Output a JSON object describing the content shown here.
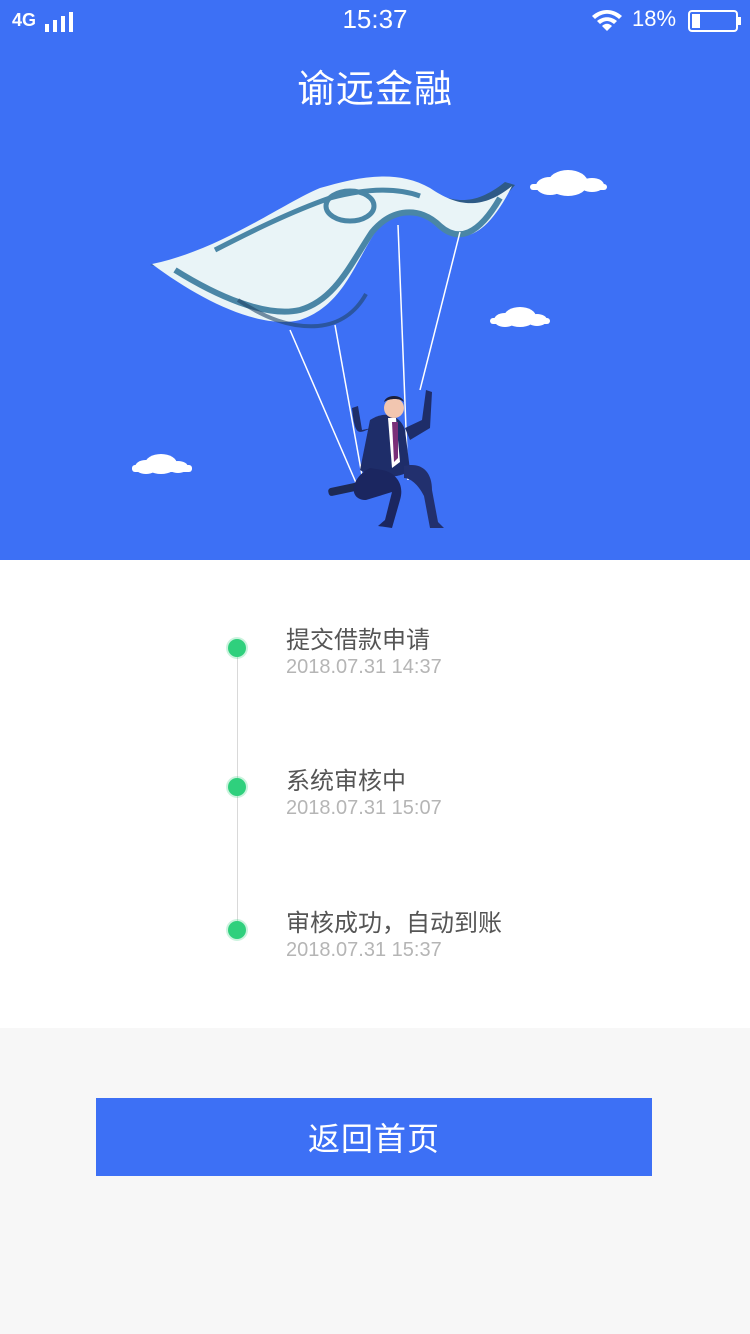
{
  "status_bar": {
    "network": "4G",
    "time": "15:37",
    "battery": "18%"
  },
  "header": {
    "title": "谕远金融"
  },
  "timeline": [
    {
      "title": "提交借款申请",
      "time": "2018.07.31  14:37"
    },
    {
      "title": "系统审核中",
      "time": "2018.07.31  15:07"
    },
    {
      "title": "审核成功，自动到账",
      "time": "2018.07.31  15:37"
    }
  ],
  "actions": {
    "home_label": "返回首页"
  },
  "colors": {
    "primary": "#3d70f5",
    "success_dot": "#2fd07d",
    "page_background": "#f7f7f7"
  },
  "icons": {
    "signal": "signal-icon",
    "wifi": "wifi-icon",
    "battery": "battery-icon"
  }
}
